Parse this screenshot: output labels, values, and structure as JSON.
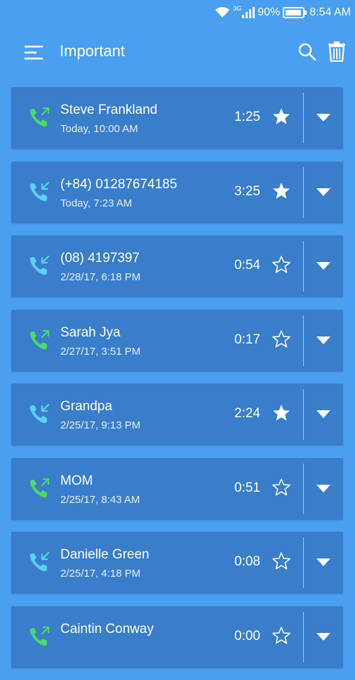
{
  "status_bar": {
    "network": "3G",
    "battery": "90%",
    "time": "8:54 AM"
  },
  "header": {
    "title": "Important",
    "menu_icon": "menu-icon",
    "search_icon": "search-icon",
    "delete_icon": "trash-icon"
  },
  "colors": {
    "background": "#4b9ff0",
    "card": "#3a7dcb",
    "outgoing": "#4cd964",
    "incoming": "#5ad2f0"
  },
  "calls": [
    {
      "name": "Steve Frankland",
      "time": "Today, 10:00 AM",
      "duration": "1:25",
      "direction": "outgoing",
      "starred": true
    },
    {
      "name": "(+84) 01287674185",
      "time": "Today, 7:23 AM",
      "duration": "3:25",
      "direction": "incoming",
      "starred": true
    },
    {
      "name": "(08) 4197397",
      "time": "2/28/17, 6:18 PM",
      "duration": "0:54",
      "direction": "incoming",
      "starred": false
    },
    {
      "name": "Sarah Jya",
      "time": "2/27/17, 3:51 PM",
      "duration": "0:17",
      "direction": "outgoing",
      "starred": false
    },
    {
      "name": "Grandpa",
      "time": "2/25/17, 9:13 PM",
      "duration": "2:24",
      "direction": "incoming",
      "starred": true
    },
    {
      "name": "MOM",
      "time": "2/25/17, 8:43 AM",
      "duration": "0:51",
      "direction": "outgoing",
      "starred": false
    },
    {
      "name": "Danielle Green",
      "time": "2/25/17, 4:18 PM",
      "duration": "0:08",
      "direction": "incoming",
      "starred": false
    },
    {
      "name": "Caintin Conway",
      "time": "",
      "duration": "0:00",
      "direction": "outgoing",
      "starred": false
    }
  ]
}
